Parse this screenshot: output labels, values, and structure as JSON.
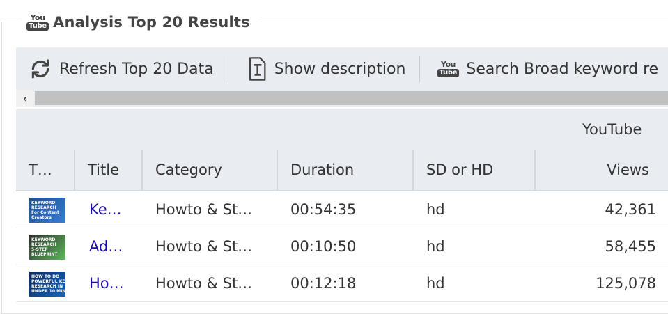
{
  "window": {
    "title": "Analysis Top 20 Results"
  },
  "icons": {
    "legend_icon": "youtube-logo-icon",
    "refresh_icon": "refresh-icon",
    "description_icon": "text-document-icon",
    "search_icon": "youtube-logo-icon"
  },
  "youtube_logo": {
    "you": "You",
    "tube": "Tube"
  },
  "toolbar": {
    "refresh_label": "Refresh Top 20 Data",
    "description_label": "Show description",
    "search_label": "Search Broad keyword re"
  },
  "scrollbar": {
    "left_arrow": "‹"
  },
  "grid": {
    "group_header": "YouTube",
    "columns": [
      "T…",
      "Title",
      "Category",
      "Duration",
      "SD or HD",
      "Views"
    ],
    "rows": [
      {
        "thumbnail_text": [
          "KEYWORD",
          "RESEARCH",
          "For Content",
          "Creators"
        ],
        "thumbnail_colors": [
          "#1d4f8c",
          "#3a7bd5"
        ],
        "title": "Ke…",
        "category": "Howto & St…",
        "duration": "00:54:35",
        "quality": "hd",
        "views": "42,361"
      },
      {
        "thumbnail_text": [
          "KEYWORD",
          "RESEARCH",
          "5-STEP",
          "BLUEPRINT"
        ],
        "thumbnail_colors": [
          "#2c2c2c",
          "#5cb85c"
        ],
        "title": "Ad…",
        "category": "Howto & St…",
        "duration": "00:10:50",
        "quality": "hd",
        "views": "58,455"
      },
      {
        "thumbnail_text": [
          "HOW TO DO",
          "POWERFUL KEYWORD",
          "RESEARCH IN",
          "UNDER 10 MINUTES"
        ],
        "thumbnail_colors": [
          "#0d2a5c",
          "#1565c0"
        ],
        "title": "Ho…",
        "category": "Howto & St…",
        "duration": "00:12:18",
        "quality": "hd",
        "views": "125,078"
      }
    ]
  }
}
